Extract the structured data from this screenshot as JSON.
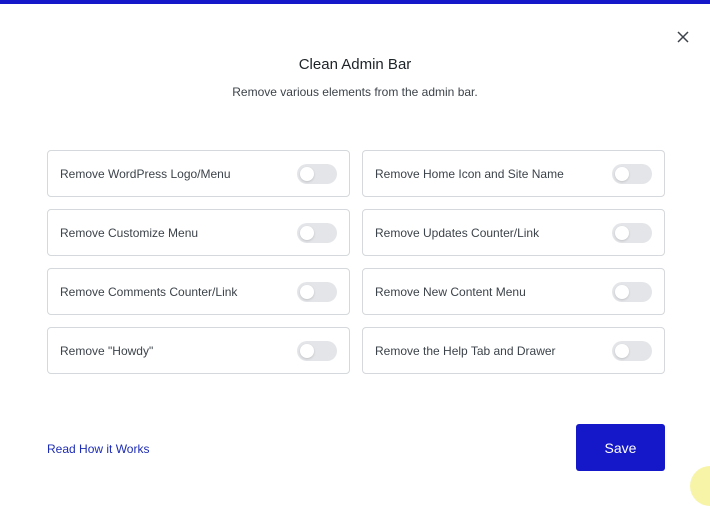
{
  "modal": {
    "title": "Clean Admin Bar",
    "subtitle": "Remove various elements from the admin bar.",
    "close_icon": "close-icon"
  },
  "options": [
    {
      "label": "Remove WordPress Logo/Menu",
      "enabled": false
    },
    {
      "label": "Remove Home Icon and Site Name",
      "enabled": false
    },
    {
      "label": "Remove Customize Menu",
      "enabled": false
    },
    {
      "label": "Remove Updates Counter/Link",
      "enabled": false
    },
    {
      "label": "Remove Comments Counter/Link",
      "enabled": false
    },
    {
      "label": "Remove New Content Menu",
      "enabled": false
    },
    {
      "label": "Remove \"Howdy\"",
      "enabled": false
    },
    {
      "label": "Remove the Help Tab and Drawer",
      "enabled": false
    }
  ],
  "footer": {
    "link_label": "Read How it Works",
    "save_label": "Save"
  },
  "colors": {
    "accent": "#1418c8",
    "toggle_off": "#e3e5e8",
    "border": "#d5d8dc",
    "link": "#1d2cb4"
  }
}
